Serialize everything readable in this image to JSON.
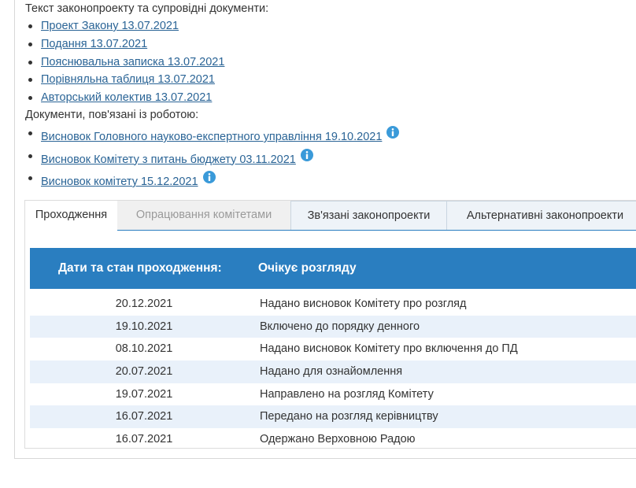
{
  "documents": {
    "text_heading": "Текст законопроекту та супровідні документи:",
    "text_links": [
      {
        "label": "Проект Закону 13.07.2021"
      },
      {
        "label": "Подання 13.07.2021"
      },
      {
        "label": "Пояснювальна записка 13.07.2021"
      },
      {
        "label": "Порівняльна таблиця 13.07.2021"
      },
      {
        "label": "Авторський колектив 13.07.2021"
      }
    ],
    "related_heading": "Документи, пов'язані із роботою:",
    "related_links": [
      {
        "label": "Висновок Головного науково-експертного управління 19.10.2021",
        "icon": "info-icon"
      },
      {
        "label": "Висновок Комітету з питань бюджету 03.11.2021",
        "icon": "info-icon"
      },
      {
        "label": "Висновок комітету 15.12.2021",
        "icon": "info-icon"
      }
    ]
  },
  "tabs": [
    {
      "label": "Проходження",
      "state": "active"
    },
    {
      "label": "Опрацювання комітетами",
      "state": "disabled"
    },
    {
      "label": "Зв'язані законопроекти",
      "state": "normal"
    },
    {
      "label": "Альтернативні законопроекти",
      "state": "normal"
    }
  ],
  "status_table": {
    "header_label": "Дати та стан проходження:",
    "header_status": "Очікує розгляду",
    "rows": [
      {
        "date": "20.12.2021",
        "event": "Надано висновок Комітету про розгляд"
      },
      {
        "date": "19.10.2021",
        "event": "Включено до порядку денного"
      },
      {
        "date": "08.10.2021",
        "event": "Надано висновок Комітету про включення до ПД"
      },
      {
        "date": "20.07.2021",
        "event": "Надано для ознайомлення"
      },
      {
        "date": "19.07.2021",
        "event": "Направлено на розгляд Комітету"
      },
      {
        "date": "16.07.2021",
        "event": "Передано на розгляд керівництву"
      },
      {
        "date": "16.07.2021",
        "event": "Одержано Верховною Радою"
      }
    ]
  },
  "colors": {
    "link": "#2a6496",
    "accent": "#2a7ec0",
    "row_alt": "#e9f1fa",
    "info_icon": "#3a9ad9"
  }
}
